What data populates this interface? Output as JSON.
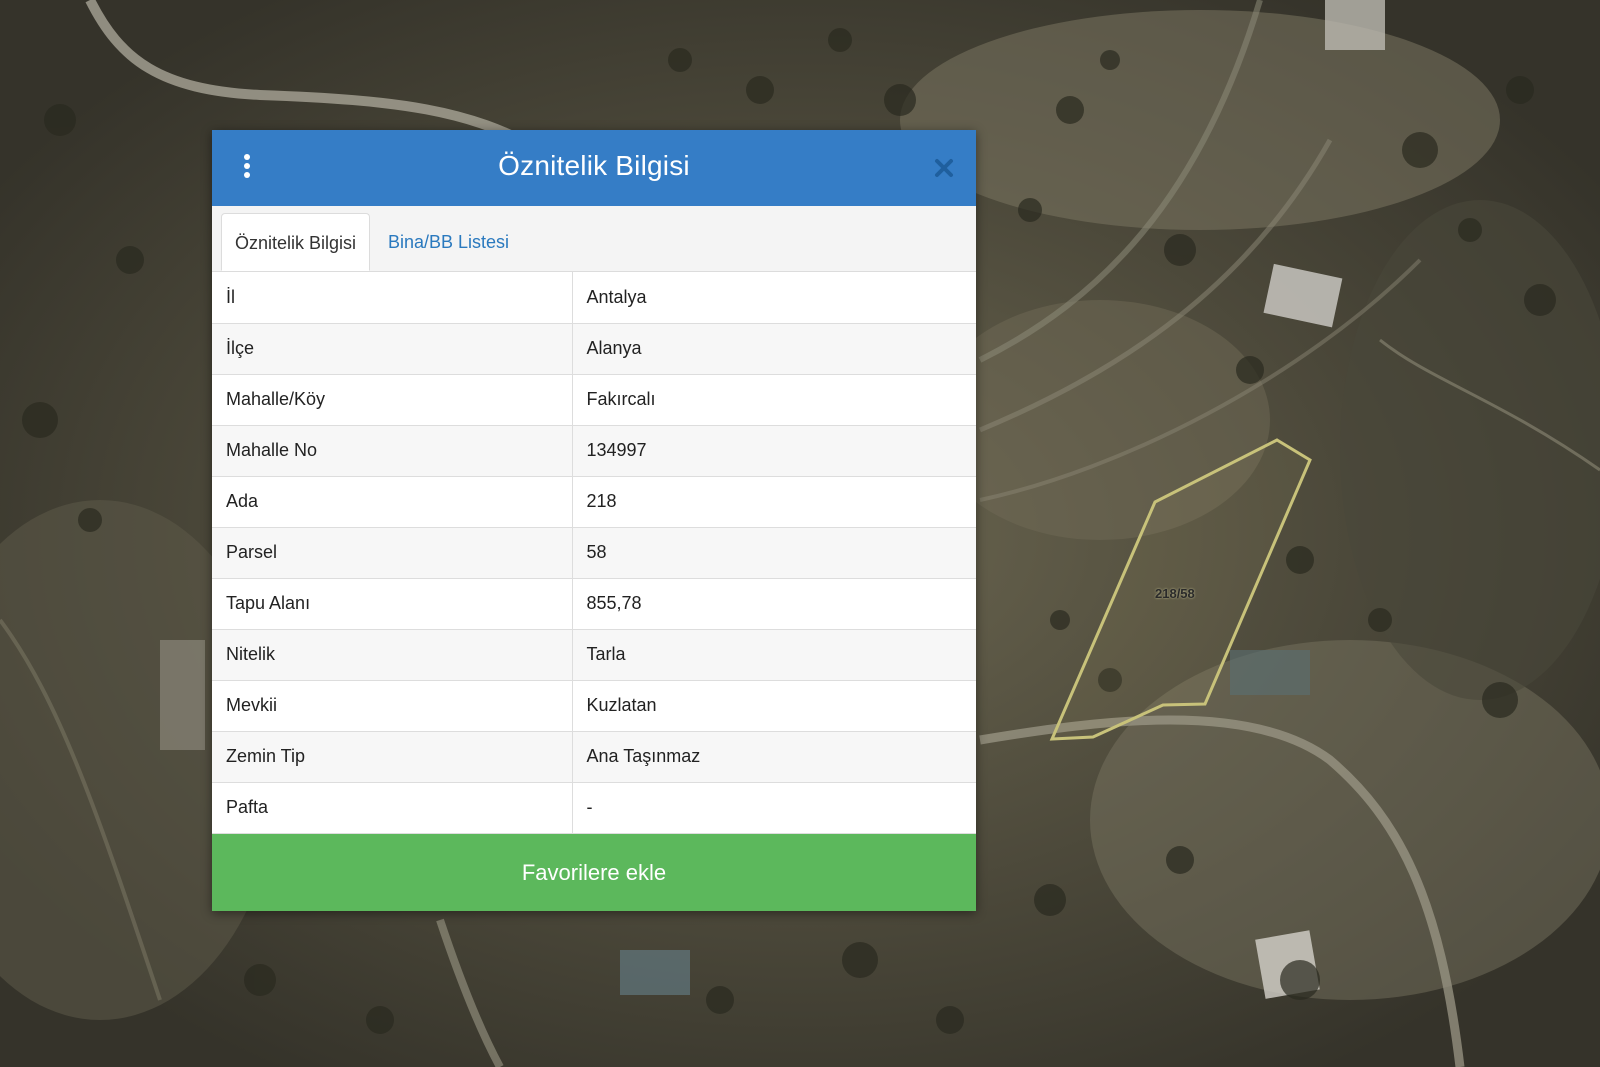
{
  "map": {
    "parcel_label": "218/58"
  },
  "dialog": {
    "title": "Öznitelik Bilgisi",
    "menu_icon": "vertical-dots-icon",
    "close_icon": "close-icon",
    "tabs": [
      {
        "label": "Öznitelik Bilgisi",
        "active": true
      },
      {
        "label": "Bina/BB Listesi",
        "active": false
      }
    ],
    "rows": [
      {
        "key": "İl",
        "value": "Antalya"
      },
      {
        "key": "İlçe",
        "value": "Alanya"
      },
      {
        "key": "Mahalle/Köy",
        "value": "Fakırcalı"
      },
      {
        "key": "Mahalle No",
        "value": "134997"
      },
      {
        "key": "Ada",
        "value": "218"
      },
      {
        "key": "Parsel",
        "value": "58"
      },
      {
        "key": "Tapu Alanı",
        "value": "855,78"
      },
      {
        "key": "Nitelik",
        "value": "Tarla"
      },
      {
        "key": "Mevkii",
        "value": "Kuzlatan"
      },
      {
        "key": "Zemin Tip",
        "value": "Ana Taşınmaz"
      },
      {
        "key": "Pafta",
        "value": "-"
      }
    ],
    "favorite_button": "Favorilere ekle"
  },
  "colors": {
    "header": "#357dc6",
    "tab_link": "#2a79be",
    "button": "#5cb85c",
    "parcel_outline": "#c8c27a"
  }
}
